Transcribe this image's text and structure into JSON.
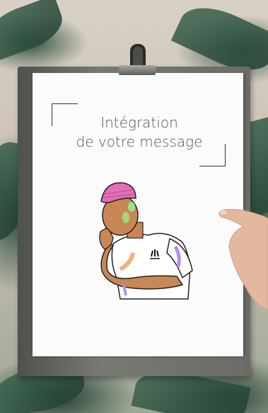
{
  "message": {
    "line1": "Intégration",
    "line2": "de votre message"
  },
  "colors": {
    "paper": "#fbfbfb",
    "text": "#555555",
    "beanie": "#e46fb5",
    "shirt": "#ffffff",
    "skin": "#c98756",
    "accent_green": "#9fe08a",
    "accent_purple": "#b68cf2"
  },
  "icons": {
    "clipboard": "clipboard-icon",
    "clip": "metal-clip-icon",
    "illustration": "man-in-beanie-illustration"
  }
}
